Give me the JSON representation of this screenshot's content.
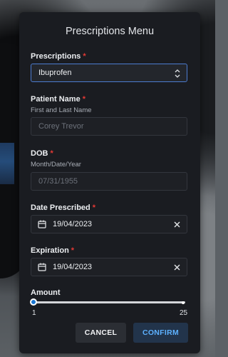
{
  "modal": {
    "title": "Prescriptions Menu",
    "required_marker": "*",
    "prescriptions": {
      "label": "Prescriptions",
      "value": "Ibuprofen"
    },
    "patient_name": {
      "label": "Patient Name",
      "hint": "First and Last Name",
      "placeholder": "Corey Trevor"
    },
    "dob": {
      "label": "DOB",
      "hint": "Month/Date/Year",
      "placeholder": "07/31/1955"
    },
    "date_prescribed": {
      "label": "Date Prescribed",
      "value": "19/04/2023"
    },
    "expiration": {
      "label": "Expiration",
      "value": "19/04/2023"
    },
    "amount": {
      "label": "Amount",
      "min": "1",
      "max": "25",
      "value": 1
    },
    "buttons": {
      "cancel": "CANCEL",
      "confirm": "CONFIRM"
    }
  },
  "colors": {
    "accent": "#4c7bd0",
    "required": "#e53935",
    "confirm_text": "#5db1ff",
    "slider_thumb": "#1976d2"
  },
  "icons": {
    "select": "chevron-up-down-icon",
    "date": "calendar-icon",
    "clear": "close-icon"
  }
}
